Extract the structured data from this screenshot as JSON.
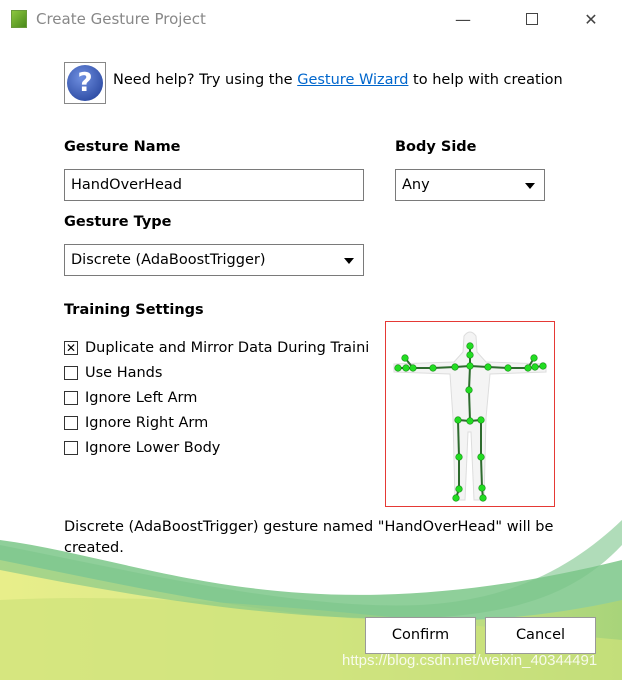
{
  "window": {
    "title": "Create Gesture Project",
    "icon": "gesture-app-icon"
  },
  "help": {
    "icon": "question-icon",
    "prefix": "Need help? Try using the ",
    "link": "Gesture Wizard",
    "suffix": " to help with creation"
  },
  "gesture_name": {
    "label": "Gesture Name",
    "value": "HandOverHead"
  },
  "body_side": {
    "label": "Body Side",
    "value": "Any"
  },
  "gesture_type": {
    "label": "Gesture Type",
    "value": "Discrete (AdaBoostTrigger)"
  },
  "training": {
    "label": "Training Settings",
    "options": [
      {
        "label": "Duplicate and Mirror Data During Traini",
        "checked": true
      },
      {
        "label": "Use Hands",
        "checked": false
      },
      {
        "label": "Ignore Left Arm",
        "checked": false
      },
      {
        "label": "Ignore Right Arm",
        "checked": false
      },
      {
        "label": "Ignore Lower Body",
        "checked": false
      }
    ]
  },
  "skeleton": {
    "joint_color": "#22dd22",
    "bone_color": "#2e6b2e",
    "border_color": "#e53935"
  },
  "summary": "Discrete (AdaBoostTrigger) gesture named \"HandOverHead\" will be created.",
  "buttons": {
    "confirm": "Confirm",
    "cancel": "Cancel"
  },
  "watermark": "https://blog.csdn.net/weixin_40344491"
}
